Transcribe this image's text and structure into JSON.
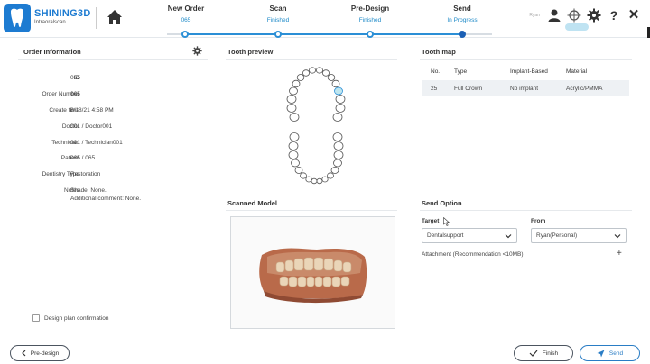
{
  "brand": {
    "name": "SHINING3D",
    "subtitle": "Intraoralscan"
  },
  "steps": [
    {
      "title": "New Order",
      "status": "065"
    },
    {
      "title": "Scan",
      "status": "Finished"
    },
    {
      "title": "Pre-Design",
      "status": "Finished"
    },
    {
      "title": "Send",
      "status": "In Progress"
    }
  ],
  "header_right": {
    "user": "Ryan"
  },
  "order_info": {
    "title": "Order Information",
    "rows": [
      {
        "label": "ID",
        "value": "065"
      },
      {
        "label": "Order Number",
        "value": "065"
      },
      {
        "label": "Create time",
        "value": "8/18/21 4:58 PM"
      },
      {
        "label": "Doctor",
        "value": "001 / Doctor001"
      },
      {
        "label": "Technician",
        "value": "001 / Technician001"
      },
      {
        "label": "Patient",
        "value": "065 / 065"
      },
      {
        "label": "Dentistry Type",
        "value": "Restoration"
      }
    ],
    "notes_label": "Notes",
    "notes_line1": "Shade: None.",
    "notes_line2": "Additional comment: None.",
    "checkbox_label": "Design plan confirmation"
  },
  "tooth_preview": {
    "title": "Tooth preview"
  },
  "scanned_model": {
    "title": "Scanned Model"
  },
  "tooth_map": {
    "title": "Tooth map",
    "headers": [
      "No.",
      "Type",
      "Implant-Based",
      "Material"
    ],
    "rows": [
      [
        "25",
        "Full Crown",
        "No implant",
        "Acrylic/PMMA"
      ]
    ]
  },
  "send_option": {
    "title": "Send Option",
    "target_label": "Target",
    "target_value": "Dentalsupport",
    "from_label": "From",
    "from_value": "Ryan(Personal)",
    "attachment_label": "Attachment (Recommendation <10MB)",
    "plus": "+"
  },
  "footer": {
    "back_label": "Pre-design",
    "finish_label": "Finish",
    "send_label": "Send"
  },
  "colors": {
    "accent": "#2b8fd6",
    "brand": "#1d7bd1"
  }
}
